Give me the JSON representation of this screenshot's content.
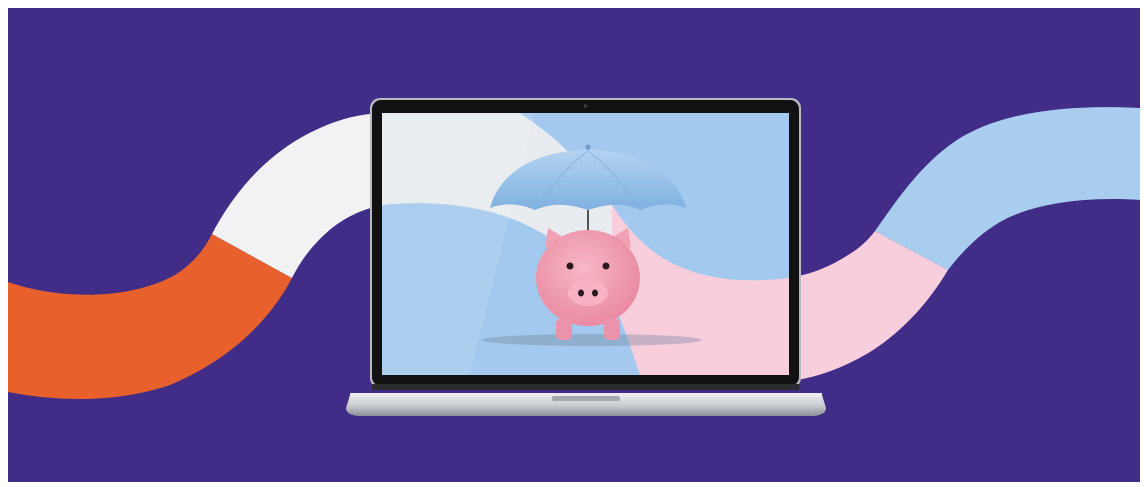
{
  "banner": {
    "colors": {
      "background": "#412C87",
      "frame": "#ffffff",
      "ribbon_orange": "#E8612C",
      "ribbon_white": "#F2F2F4",
      "ribbon_pink": "#F8CEDD",
      "ribbon_blue": "#A9CDEE",
      "screen_blue": "#A3CAEE",
      "umbrella": "#9CC3EA",
      "piggy_bank": "#F4A3B6",
      "laptop_silver": "#C9CCD1",
      "bezel": "#111114"
    },
    "icons": [
      "laptop-icon",
      "umbrella-icon",
      "piggy-bank-icon"
    ]
  }
}
